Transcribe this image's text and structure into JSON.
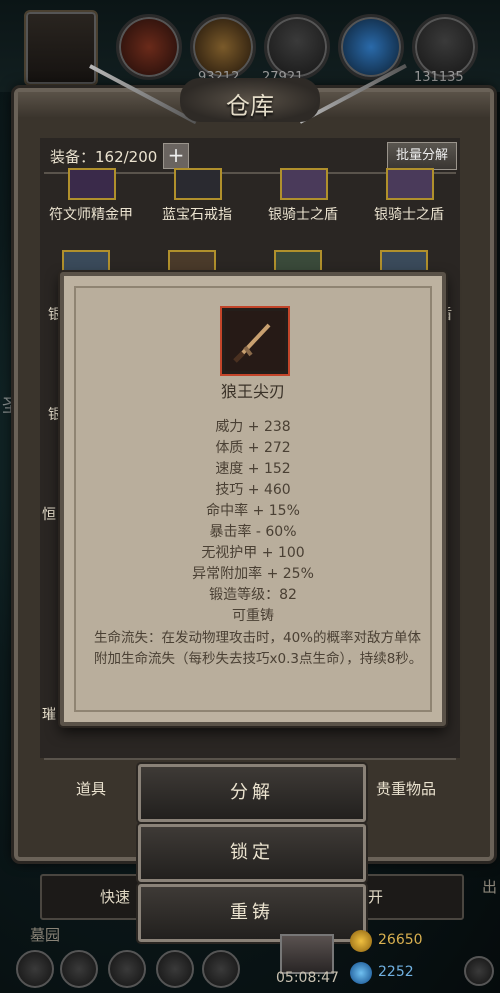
{
  "top": {
    "numbers": [
      "93212",
      "27921",
      "131135"
    ]
  },
  "warehouse": {
    "title": "仓库",
    "equip_label": "装备：162/200",
    "plus": "+",
    "batch_decompose": "批量分解"
  },
  "items_row1": [
    "符文师精金甲",
    "蓝宝石戒指",
    "银骑士之盾",
    "银骑士之盾"
  ],
  "side_fragments": {
    "left": [
      "银",
      "银",
      "恒",
      "璀"
    ],
    "right": "盾",
    "far_left": "圣"
  },
  "tabs": {
    "left": "道具",
    "right": "贵重物品"
  },
  "tooltip": {
    "name": "狼王尖刃",
    "stats": [
      "威力 + 238",
      "体质 + 272",
      "速度 + 152",
      "技巧 + 460",
      "命中率 + 15%",
      "暴击率 - 60%",
      "无视护甲 + 100",
      "异常附加率 + 25%",
      "锻造等级：82",
      "可重铸"
    ],
    "description": "生命流失：在发动物理攻击时，40%的概率对敌方单体附加生命流失（每秒失去技巧x0.3点生命），持续8秒。"
  },
  "actions": [
    "分解",
    "锁定",
    "重铸"
  ],
  "bottom": {
    "quick_label": "快速",
    "open_label": "开",
    "location": "墓园",
    "gold": "26650",
    "gems": "2252",
    "time": "05:08:47",
    "right_text": "出"
  }
}
